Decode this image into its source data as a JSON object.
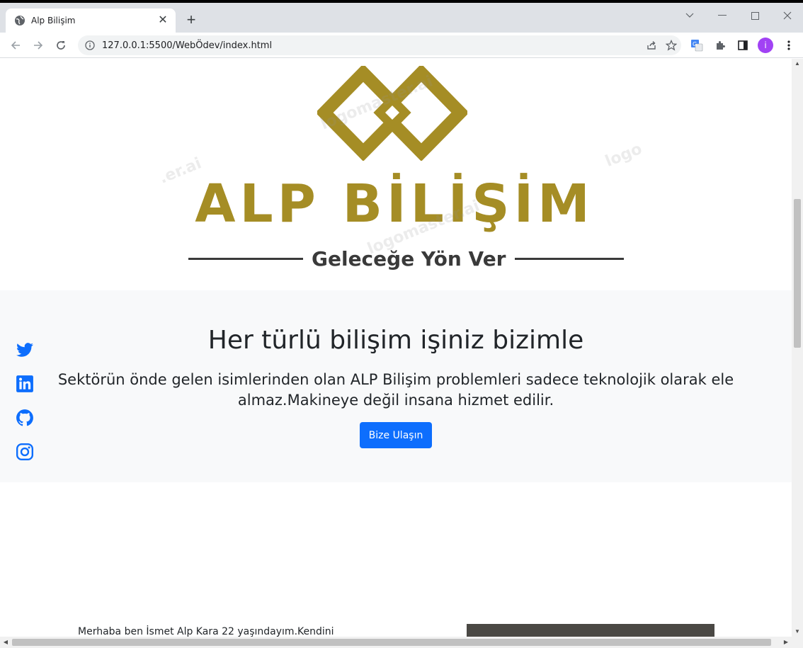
{
  "browser": {
    "tab_title": "Alp Bilişim",
    "tab_close": "✕",
    "new_tab": "+",
    "url": "127.0.0.1:5500/WebÖdev/index.html",
    "profile_initial": "i"
  },
  "logo": {
    "brand": "ALP BİLİŞİM",
    "tagline": "Geleceğe Yön Ver",
    "brand_color": "#a58d25",
    "watermarks": [
      "logomaster.ai",
      ".er.ai",
      "logo",
      "logomaster.ai"
    ]
  },
  "hero": {
    "title": "Her türlü bilişim işiniz bizimle",
    "lead": "Sektörün önde gelen isimlerinden olan ALP Bilişim problemleri sadece teknolojik olarak ele almaz.Makineye değil insana hizmet edilir.",
    "cta_label": "Bize Ulaşın",
    "cta_color": "#0d6efd"
  },
  "social": {
    "color": "#0d6efd",
    "icons": [
      "twitter-icon",
      "linkedin-icon",
      "github-icon",
      "instagram-icon"
    ]
  },
  "about": {
    "intro": "Merhaba ben İsmet Alp Kara 22 yaşındayım.Kendini"
  }
}
